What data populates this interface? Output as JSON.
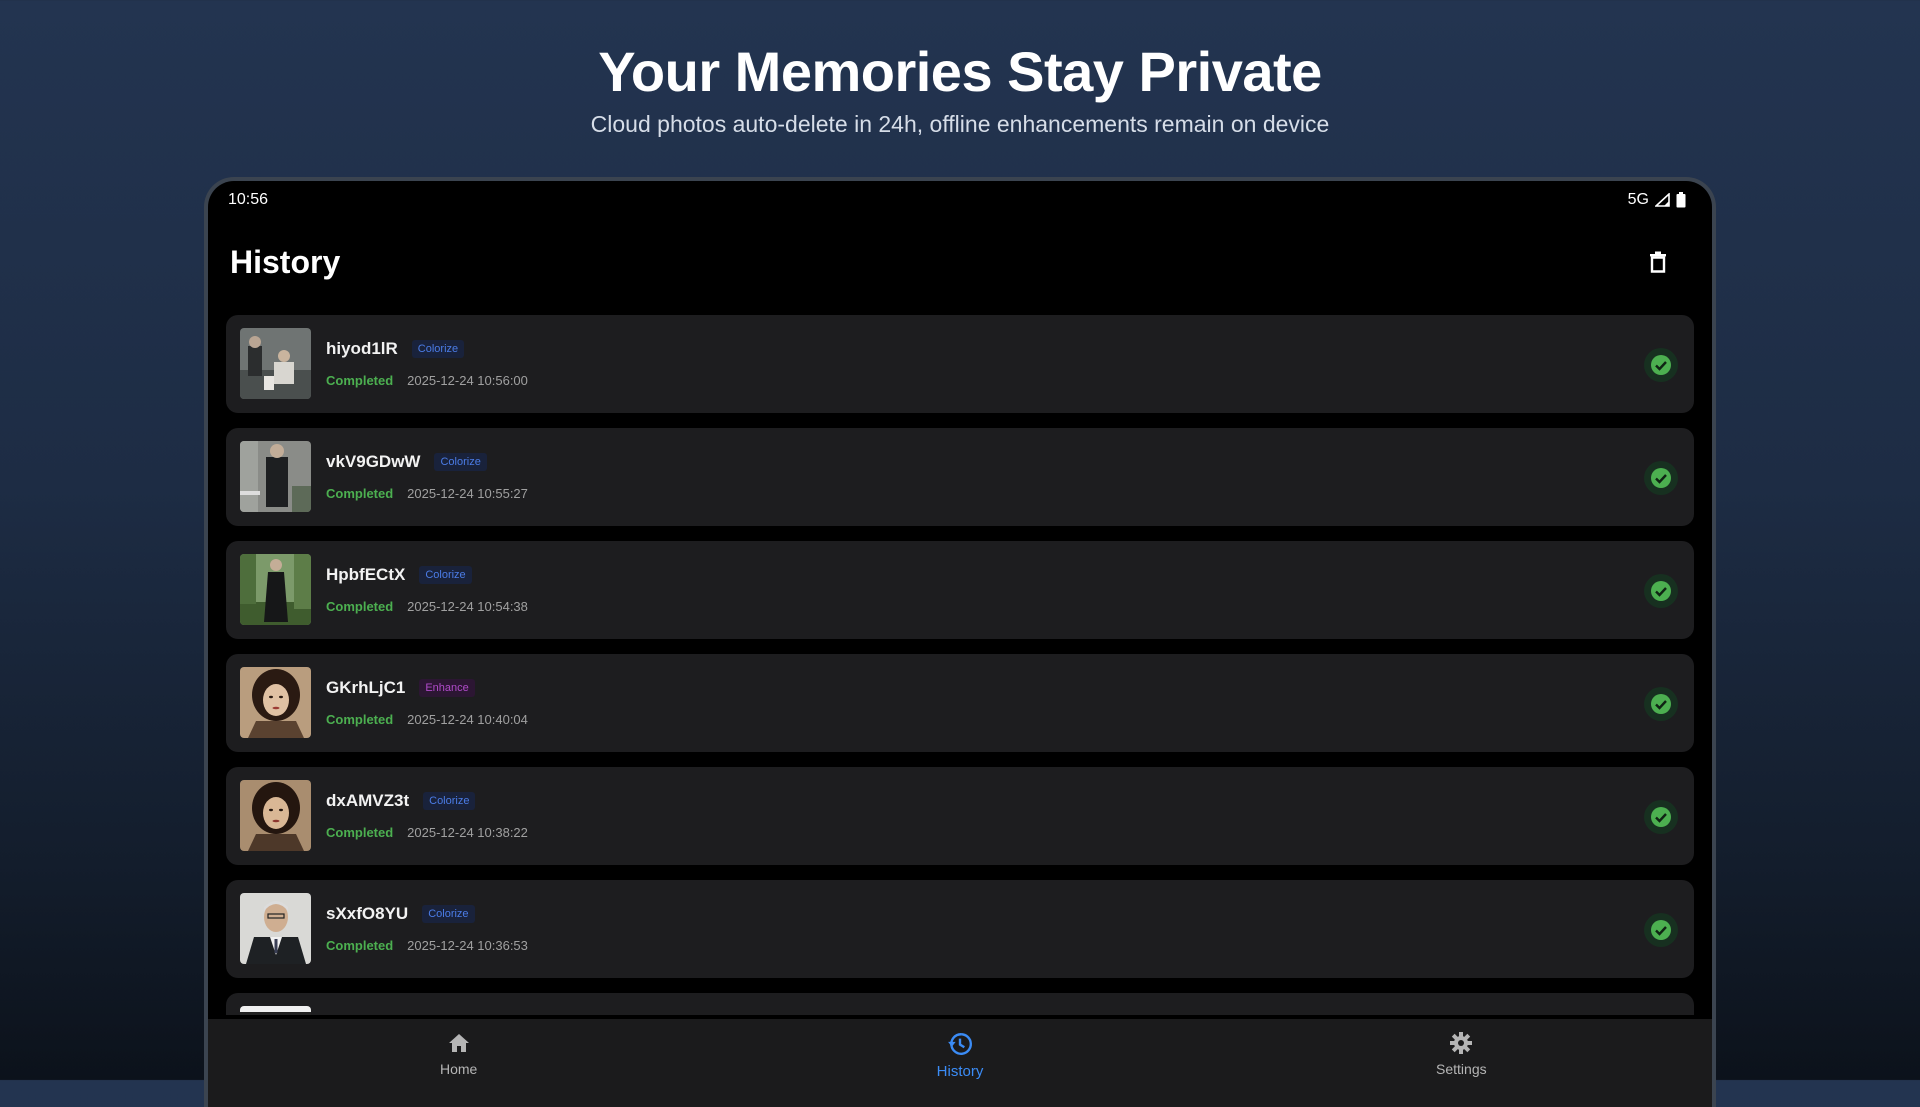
{
  "promo": {
    "headline": "Your Memories Stay Private",
    "subline": "Cloud photos auto-delete in 24h, offline enhancements remain on device"
  },
  "status_bar": {
    "time": "10:56",
    "network": "5G"
  },
  "header": {
    "title": "History",
    "delete_icon": "trash-icon"
  },
  "colors": {
    "accent": "#3b8cf6",
    "success": "#4caf50",
    "colorize_tag": "#4b7ce6",
    "enhance_tag": "#b04bc9",
    "card_bg": "#1d1d1f"
  },
  "history": [
    {
      "name": "hiyod1lR",
      "type": "Colorize",
      "status": "Completed",
      "timestamp": "2025-12-24 10:56:00"
    },
    {
      "name": "vkV9GDwW",
      "type": "Colorize",
      "status": "Completed",
      "timestamp": "2025-12-24 10:55:27"
    },
    {
      "name": "HpbfECtX",
      "type": "Colorize",
      "status": "Completed",
      "timestamp": "2025-12-24 10:54:38"
    },
    {
      "name": "GKrhLjC1",
      "type": "Enhance",
      "status": "Completed",
      "timestamp": "2025-12-24 10:40:04"
    },
    {
      "name": "dxAMVZ3t",
      "type": "Colorize",
      "status": "Completed",
      "timestamp": "2025-12-24 10:38:22"
    },
    {
      "name": "sXxfO8YU",
      "type": "Colorize",
      "status": "Completed",
      "timestamp": "2025-12-24 10:36:53"
    }
  ],
  "nav": [
    {
      "label": "Home",
      "icon": "home-icon",
      "active": false
    },
    {
      "label": "History",
      "icon": "history-icon",
      "active": true
    },
    {
      "label": "Settings",
      "icon": "gear-icon",
      "active": false
    }
  ]
}
